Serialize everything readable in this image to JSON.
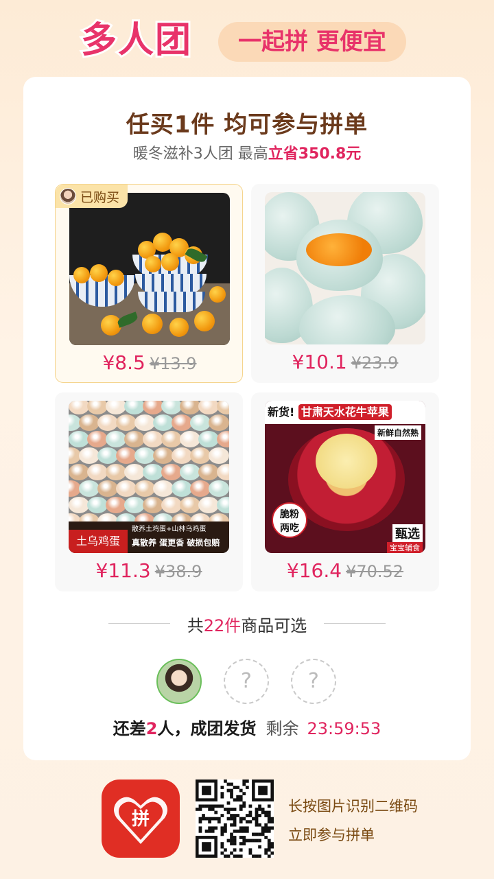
{
  "header": {
    "logo": "多人团",
    "slogan": "一起拼 更便宜"
  },
  "card": {
    "title": "任买1件 均可参与拼单",
    "subtitle_prefix": "暖冬滋补3人团 最高",
    "subtitle_save": "立省350.8元"
  },
  "products": [
    {
      "price": "¥8.5",
      "original_price": "¥13.9",
      "bought_tag": "已购买"
    },
    {
      "price": "¥10.1",
      "original_price": "¥23.9"
    },
    {
      "price": "¥11.3",
      "original_price": "¥38.9",
      "banner_tag": "土乌鸡蛋",
      "banner_line1": "散养土鸡蛋+山林乌鸡蛋",
      "banner_line2": "真散养 蛋更香 破损包赔"
    },
    {
      "price": "¥16.4",
      "original_price": "¥70.52",
      "head_new": "新货!",
      "head_name": "甘肃天水花牛苹果",
      "sub": "新鲜自然熟",
      "badge_line1": "脆粉",
      "badge_line2": "两吃",
      "choice": "甄选",
      "choice2": "宝宝辅食"
    }
  ],
  "count": {
    "prefix": "共",
    "num": "22件",
    "suffix": "商品可选"
  },
  "group": {
    "empty_slot": "?",
    "status_prefix": "还差",
    "status_num": "2",
    "status_suffix": "人，成团发货",
    "remaining_label": "剩余",
    "countdown": "23:59:53"
  },
  "footer": {
    "line1": "长按图片识别二维码",
    "line2": "立即参与拼单",
    "app_icon_glyph": "拼"
  },
  "colors": {
    "accent": "#e0245e",
    "brand": "#e02e24",
    "bought_tag_bg": "#fbe3a8"
  }
}
